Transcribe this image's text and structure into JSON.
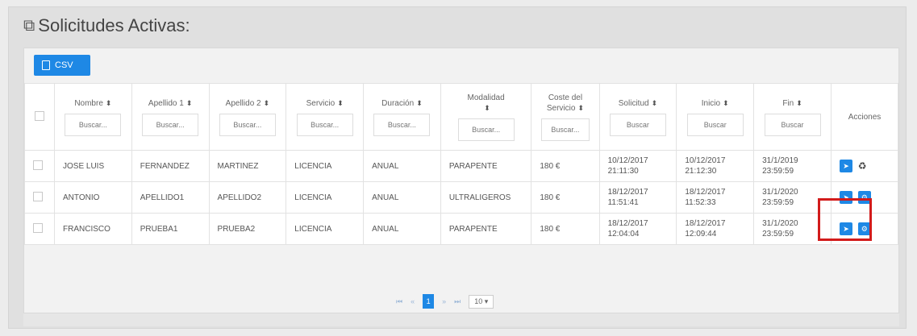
{
  "header": {
    "title": "Solicitudes Activas:",
    "title_icon": "copy-icon"
  },
  "toolbar": {
    "csv_label": "CSV",
    "csv_icon": "file-icon"
  },
  "table": {
    "columns": [
      {
        "label": "Nombre",
        "placeholder": "Buscar..."
      },
      {
        "label": "Apellido 1",
        "placeholder": "Buscar..."
      },
      {
        "label": "Apellido 2",
        "placeholder": "Buscar..."
      },
      {
        "label": "Servicio",
        "placeholder": "Buscar..."
      },
      {
        "label": "Duración",
        "placeholder": "Buscar..."
      },
      {
        "label": "Modalidad",
        "placeholder": "Buscar..."
      },
      {
        "label": "Coste del Servicio",
        "placeholder": "Buscar..."
      },
      {
        "label": "Solicitud",
        "placeholder": "Buscar"
      },
      {
        "label": "Inicio",
        "placeholder": "Buscar"
      },
      {
        "label": "Fin",
        "placeholder": "Buscar"
      },
      {
        "label": "Acciones"
      }
    ],
    "rows": [
      {
        "nombre": "JOSE LUIS",
        "apellido1": "FERNANDEZ",
        "apellido2": "MARTINEZ",
        "servicio": "LICENCIA",
        "duracion": "ANUAL",
        "modalidad": "PARAPENTE",
        "coste": "180 €",
        "solicitud": [
          "10/12/2017",
          "21:11:30"
        ],
        "inicio": [
          "10/12/2017",
          "21:12:30"
        ],
        "fin": [
          "31/1/2019",
          "23:59:59"
        ]
      },
      {
        "nombre": "ANTONIO",
        "apellido1": "APELLIDO1",
        "apellido2": "APELLIDO2",
        "servicio": "LICENCIA",
        "duracion": "ANUAL",
        "modalidad": "ULTRALIGEROS",
        "coste": "180 €",
        "solicitud": [
          "18/12/2017",
          "11:51:41"
        ],
        "inicio": [
          "18/12/2017",
          "11:52:33"
        ],
        "fin": [
          "31/1/2020",
          "23:59:59"
        ]
      },
      {
        "nombre": "FRANCISCO",
        "apellido1": "PRUEBA1",
        "apellido2": "PRUEBA2",
        "servicio": "LICENCIA",
        "duracion": "ANUAL",
        "modalidad": "PARAPENTE",
        "coste": "180 €",
        "solicitud": [
          "18/12/2017",
          "12:04:04"
        ],
        "inicio": [
          "18/12/2017",
          "12:09:44"
        ],
        "fin": [
          "31/1/2020",
          "23:59:59"
        ]
      }
    ]
  },
  "pagination": {
    "current": "1",
    "page_size": "10 ▾"
  },
  "colors": {
    "accent": "#1e88e5",
    "highlight": "#d21b1b"
  }
}
